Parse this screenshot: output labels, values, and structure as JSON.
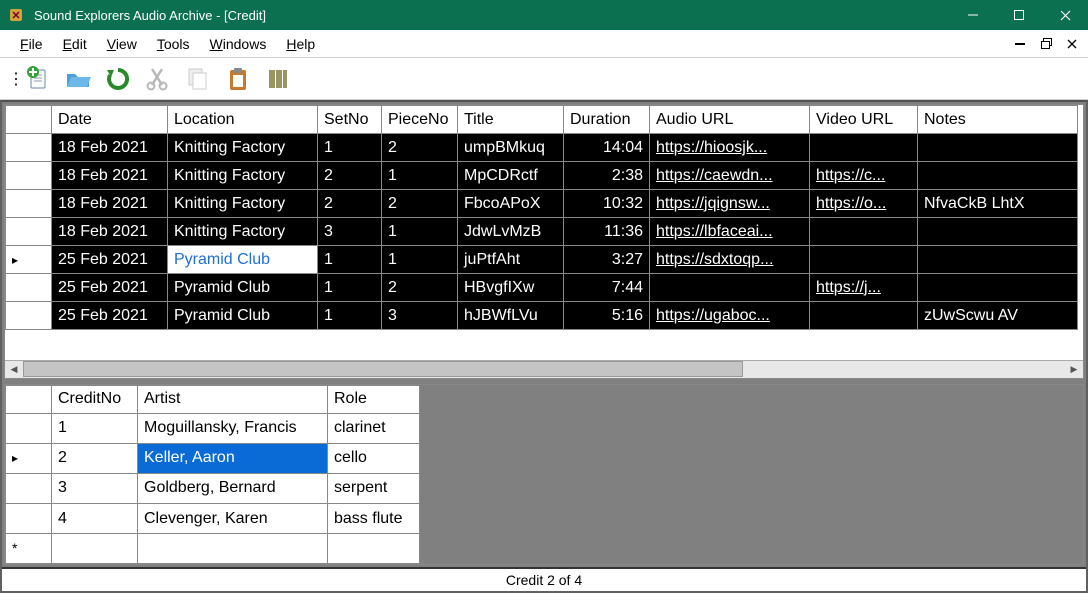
{
  "window": {
    "title": "Sound Explorers Audio Archive - [Credit]"
  },
  "menu": {
    "file": "File",
    "edit": "Edit",
    "view": "View",
    "tools": "Tools",
    "windows": "Windows",
    "help": "Help"
  },
  "top": {
    "headers": {
      "date": "Date",
      "location": "Location",
      "setno": "SetNo",
      "pieceno": "PieceNo",
      "title": "Title",
      "duration": "Duration",
      "aurl": "Audio URL",
      "vurl": "Video URL",
      "notes": "Notes"
    },
    "rows": [
      {
        "date": "18 Feb 2021",
        "location": "Knitting Factory",
        "setno": "1",
        "pieceno": "2",
        "title": "umpBMkuq",
        "duration": "14:04",
        "aurl": "https://hioosjk...",
        "vurl": "",
        "notes": "",
        "sel": false
      },
      {
        "date": "18 Feb 2021",
        "location": "Knitting Factory",
        "setno": "2",
        "pieceno": "1",
        "title": "MpCDRctf",
        "duration": "2:38",
        "aurl": "https://caewdn...",
        "vurl": "https://c...",
        "notes": "",
        "sel": false
      },
      {
        "date": "18 Feb 2021",
        "location": "Knitting Factory",
        "setno": "2",
        "pieceno": "2",
        "title": "FbcoAPoX",
        "duration": "10:32",
        "aurl": "https://jqignsw...",
        "vurl": "https://o...",
        "notes": "NfvaCkB LhtX",
        "sel": false
      },
      {
        "date": "18 Feb 2021",
        "location": "Knitting Factory",
        "setno": "3",
        "pieceno": "1",
        "title": "JdwLvMzB",
        "duration": "11:36",
        "aurl": "https://lbfaceai...",
        "vurl": "",
        "notes": "",
        "sel": false
      },
      {
        "date": "25 Feb 2021",
        "location": "Pyramid Club",
        "setno": "1",
        "pieceno": "1",
        "title": "juPtfAht",
        "duration": "3:27",
        "aurl": "https://sdxtoqp...",
        "vurl": "",
        "notes": "",
        "sel": true
      },
      {
        "date": "25 Feb 2021",
        "location": "Pyramid Club",
        "setno": "1",
        "pieceno": "2",
        "title": "HBvgfIXw",
        "duration": "7:44",
        "aurl": "",
        "vurl": "https://j...",
        "notes": "",
        "sel": false
      },
      {
        "date": "25 Feb 2021",
        "location": "Pyramid Club",
        "setno": "1",
        "pieceno": "3",
        "title": "hJBWfLVu",
        "duration": "5:16",
        "aurl": "https://ugaboc...",
        "vurl": "",
        "notes": "zUwScwu AV",
        "sel": false
      }
    ]
  },
  "bot": {
    "headers": {
      "cno": "CreditNo",
      "artist": "Artist",
      "role": "Role"
    },
    "rows": [
      {
        "cno": "1",
        "artist": "Moguillansky, Francis",
        "role": "clarinet",
        "sel": false,
        "marker": false
      },
      {
        "cno": "2",
        "artist": "Keller, Aaron",
        "role": "cello",
        "sel": true,
        "marker": true
      },
      {
        "cno": "3",
        "artist": "Goldberg, Bernard",
        "role": "serpent",
        "sel": false,
        "marker": false
      },
      {
        "cno": "4",
        "artist": "Clevenger, Karen",
        "role": "bass flute",
        "sel": false,
        "marker": false
      }
    ]
  },
  "status": {
    "text": "Credit 2 of 4"
  },
  "icons": {
    "new": "new-icon",
    "open": "open-icon",
    "refresh": "refresh-icon",
    "cut": "cut-icon",
    "copy": "copy-icon",
    "paste": "paste-icon",
    "columns": "columns-icon"
  }
}
